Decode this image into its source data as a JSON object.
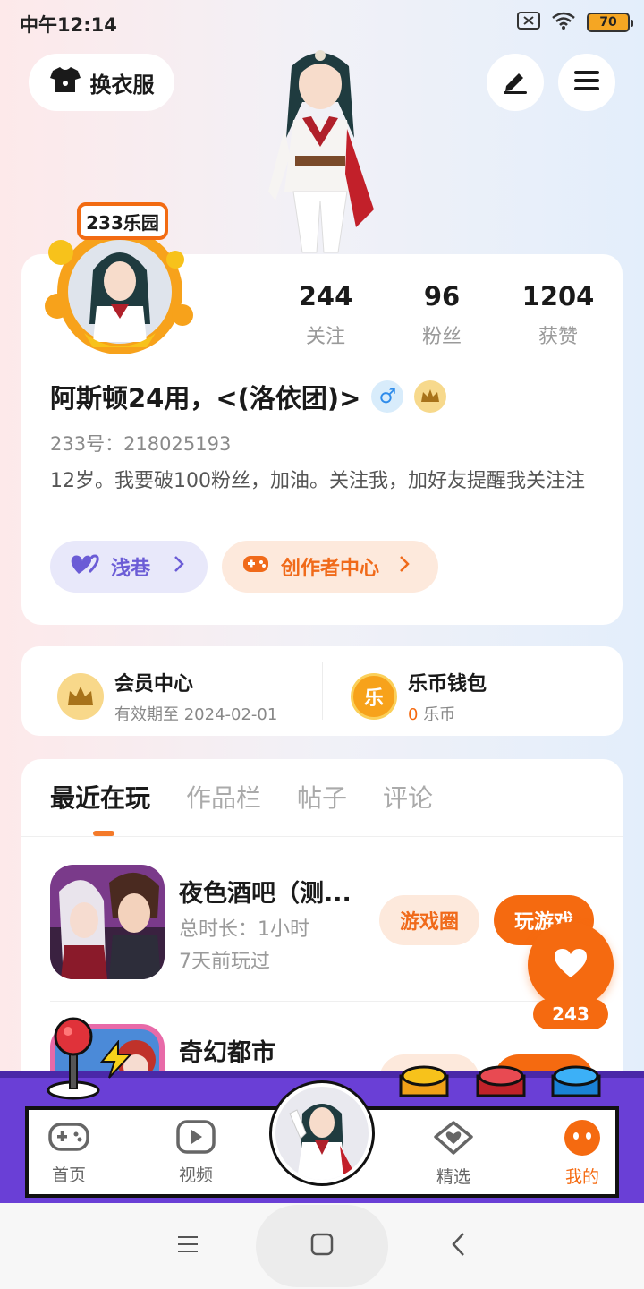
{
  "status_bar": {
    "time": "中午12:14",
    "battery": "70"
  },
  "header": {
    "outfit_label": "换衣服"
  },
  "profile": {
    "frame_badge": "233乐园",
    "stats": [
      {
        "value": "244",
        "label": "关注"
      },
      {
        "value": "96",
        "label": "粉丝"
      },
      {
        "value": "1204",
        "label": "获赞"
      }
    ],
    "username": "阿斯顿24用，<(洛依团)>",
    "gender": "♂",
    "uid": "233号：218025193",
    "bio": "12岁。我要破100粉丝，加油。关注我，加好友提醒我关注注",
    "lane_label": "浅巷",
    "creator_label": "创作者中心"
  },
  "wallet": {
    "member": {
      "title": "会员中心",
      "sub": "有效期至 2024-02-01"
    },
    "coins": {
      "title": "乐币钱包",
      "amount": "0",
      "unit": "乐币",
      "icon_text": "乐"
    }
  },
  "tabs": [
    "最近在玩",
    "作品栏",
    "帖子",
    "评论"
  ],
  "games": [
    {
      "name": "夜色酒吧（测...",
      "duration": "总时长：1小时",
      "last_played": "7天前玩过",
      "circle_label": "游戏圈",
      "play_label": "玩游戏"
    },
    {
      "name": "奇幻都市"
    }
  ],
  "like": {
    "count": "243"
  },
  "nav": {
    "home": "首页",
    "video": "视频",
    "featured": "精选",
    "mine": "我的"
  },
  "colors": {
    "accent": "#f56a10",
    "purple": "#6a3fd6"
  }
}
